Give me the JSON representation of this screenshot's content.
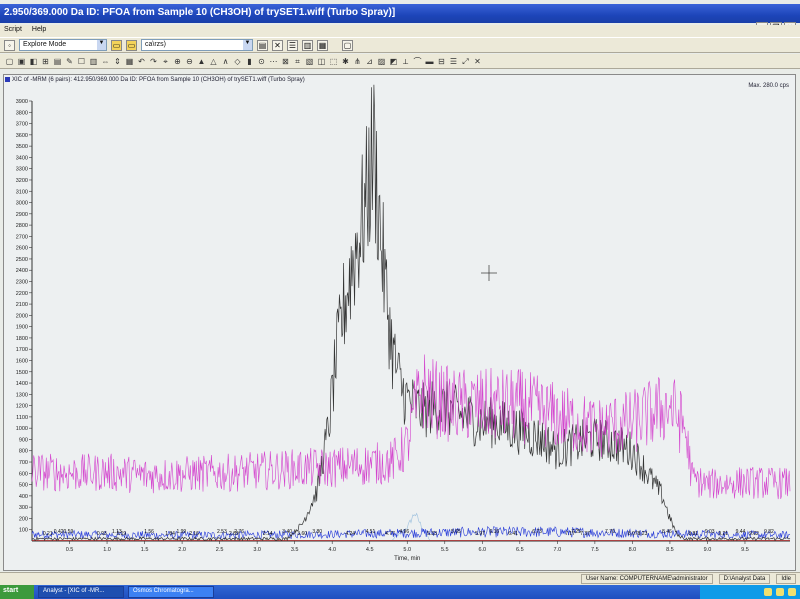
{
  "window": {
    "title": "2.950/369.000 Da ID: PFOA from Sample 10 (CH3OH) of trySET1.wiff (Turbo Spray)]"
  },
  "menu": [
    "Script",
    "Help"
  ],
  "toolbar": {
    "mode_select": "Explore Mode",
    "path_select": "ca\\rzs)"
  },
  "pane": {
    "title": "XIC of -MRM (6 pairs): 412.950/369.000 Da ID: PFOA from Sample 10 (CH3OH) of trySET1.wiff (Turbo Spray)",
    "max_label": "Max. 280.0 cps"
  },
  "status": {
    "user": "User Name: COMPUTERNAME\\administrator",
    "analyst_data": "D:\\Analyst Data",
    "idle": "Idle"
  },
  "taskbar": {
    "start": "start",
    "tasks": [
      "Analyst - [XIC of -MR...",
      "Osmos Chromatogra..."
    ]
  },
  "colors": {
    "black_trace": "#2b2b2b",
    "magenta_trace": "#d23acb",
    "blue_trace": "#1a2fd6",
    "lightblue_trace": "#86b3d8",
    "red_trace": "#d02020"
  },
  "chart_data": {
    "type": "line",
    "xlabel": "Time, min",
    "ylabel": "",
    "xlim": [
      0,
      10.1
    ],
    "ylim": [
      0,
      3900
    ],
    "x_ticks": [
      "0.5",
      "1.0",
      "1.5",
      "2.0",
      "2.5",
      "3.0",
      "3.5",
      "4.0",
      "4.5",
      "5.0",
      "5.5",
      "6.0",
      "6.5",
      "7.0",
      "7.5",
      "8.0",
      "8.5",
      "9.0",
      "9.5"
    ],
    "y_ticks": [
      "3900",
      "3800",
      "3700",
      "3600",
      "3500",
      "3400",
      "3300",
      "3200",
      "3100",
      "3000",
      "2900",
      "2800",
      "2700",
      "2600",
      "2500",
      "2400",
      "2300",
      "2200",
      "2100",
      "2000",
      "1900",
      "1800",
      "1700",
      "1600",
      "1500",
      "1400",
      "1300",
      "1200",
      "1100",
      "1000",
      "900",
      "800",
      "700",
      "600",
      "500",
      "400",
      "300",
      "200",
      "100"
    ],
    "series": [
      {
        "color": "black",
        "x": [
          0,
          3.4,
          3.6,
          3.8,
          3.95,
          4.05,
          4.15,
          4.25,
          4.35,
          4.45,
          4.55,
          4.6,
          4.7,
          4.8,
          4.9,
          5.0,
          5.2,
          5.4,
          5.6,
          5.8,
          6.0,
          6.2,
          6.4,
          6.6,
          6.8,
          7.0,
          7.2,
          7.4,
          7.6,
          7.8,
          8.0,
          8.2,
          8.4,
          8.5,
          8.6,
          8.7,
          8.8,
          10.1
        ],
        "y": [
          20,
          20,
          150,
          450,
          1000,
          1600,
          2050,
          2400,
          2700,
          3000,
          3500,
          3100,
          2300,
          1700,
          1400,
          1250,
          1150,
          1200,
          1150,
          1100,
          1050,
          1050,
          1000,
          950,
          900,
          800,
          850,
          900,
          900,
          850,
          800,
          600,
          400,
          200,
          50,
          20,
          20,
          20
        ]
      },
      {
        "color": "magenta",
        "x": [
          0,
          0.5,
          1,
          1.5,
          2,
          2.5,
          3,
          3.5,
          4,
          4.5,
          4.8,
          5.0,
          5.1,
          5.2,
          5.4,
          5.6,
          6,
          6.5,
          7,
          7.5,
          8,
          8.5,
          8.7,
          8.8,
          9,
          9.5,
          10.1
        ],
        "y": [
          620,
          600,
          610,
          580,
          590,
          600,
          620,
          640,
          650,
          680,
          700,
          850,
          1150,
          1350,
          1250,
          1200,
          1200,
          1200,
          1100,
          1000,
          1050,
          1200,
          1000,
          550,
          500,
          520,
          510
        ]
      },
      {
        "color": "blue",
        "x": [
          0,
          2,
          4,
          5,
          6,
          7,
          8,
          9,
          10.1
        ],
        "y": [
          60,
          50,
          60,
          70,
          80,
          80,
          70,
          60,
          50
        ]
      },
      {
        "color": "lightblue",
        "x": [
          4.8,
          5.0,
          5.1,
          5.2,
          5.3
        ],
        "y": [
          10,
          120,
          250,
          120,
          10
        ]
      },
      {
        "color": "red",
        "x": [
          0,
          10.1
        ],
        "y": [
          5,
          5
        ]
      }
    ],
    "peak_labels": [
      {
        "x": 0.21,
        "text": "0.21"
      },
      {
        "x": 0.42,
        "text": "0.420.59"
      },
      {
        "x": 0.93,
        "text": "0.93"
      },
      {
        "x": 1.13,
        "text": "1.13"
      },
      {
        "x": 1.19,
        "text": "1.19"
      },
      {
        "x": 1.56,
        "text": "1.56"
      },
      {
        "x": 1.84,
        "text": "1.84"
      },
      {
        "x": 1.99,
        "text": "1.99"
      },
      {
        "x": 2.16,
        "text": "2.16"
      },
      {
        "x": 2.53,
        "text": "2.53"
      },
      {
        "x": 2.69,
        "text": "2.69"
      },
      {
        "x": 2.76,
        "text": "2.76"
      },
      {
        "x": 3.14,
        "text": "3.14"
      },
      {
        "x": 3.4,
        "text": "3.40"
      },
      {
        "x": 3.6,
        "text": "3.60"
      },
      {
        "x": 3.8,
        "text": "3.80"
      },
      {
        "x": 4.24,
        "text": "4.24"
      },
      {
        "x": 4.51,
        "text": "4.51"
      },
      {
        "x": 4.77,
        "text": "4.77"
      },
      {
        "x": 4.96,
        "text": "4.96"
      },
      {
        "x": 5.33,
        "text": "5.33"
      },
      {
        "x": 5.65,
        "text": "5.65"
      },
      {
        "x": 5.97,
        "text": "5.97"
      },
      {
        "x": 6.16,
        "text": "6.16"
      },
      {
        "x": 6.41,
        "text": "6.41"
      },
      {
        "x": 6.73,
        "text": "6.73"
      },
      {
        "x": 7.17,
        "text": "7.17"
      },
      {
        "x": 7.25,
        "text": "7.25"
      },
      {
        "x": 7.37,
        "text": "7.37"
      },
      {
        "x": 7.7,
        "text": "7.70"
      },
      {
        "x": 8.07,
        "text": "8.078.23"
      },
      {
        "x": 8.46,
        "text": "8.46"
      },
      {
        "x": 8.81,
        "text": "8.81"
      },
      {
        "x": 9.03,
        "text": "9.03"
      },
      {
        "x": 9.21,
        "text": "9.21"
      },
      {
        "x": 9.44,
        "text": "9.44"
      },
      {
        "x": 9.62,
        "text": "9.62"
      },
      {
        "x": 9.82,
        "text": "9.82"
      }
    ]
  }
}
